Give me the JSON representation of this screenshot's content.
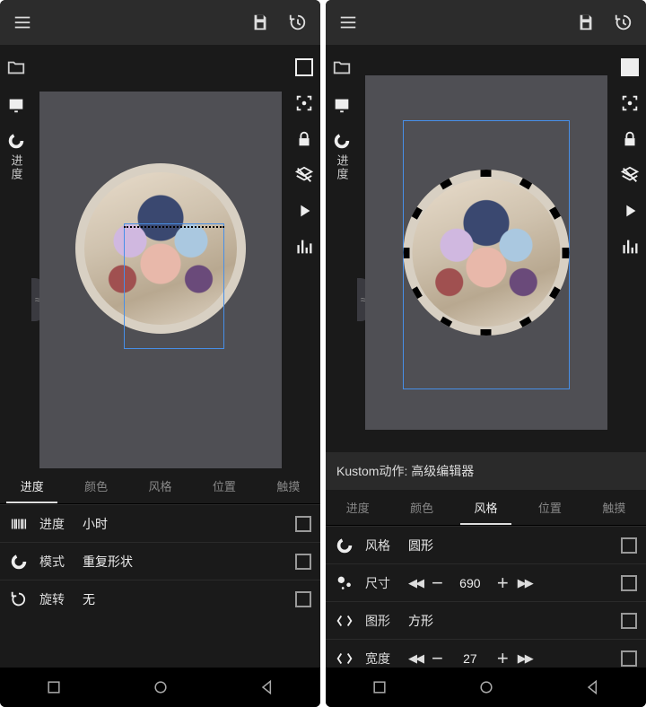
{
  "left": {
    "sidebar_sel_label": "进度",
    "tabs": [
      "进度",
      "颜色",
      "风格",
      "位置",
      "触摸"
    ],
    "active_tab": 0,
    "props": [
      {
        "icon": "barcode",
        "label": "进度",
        "value": "小时"
      },
      {
        "icon": "ring",
        "label": "模式",
        "value": "重复形状"
      },
      {
        "icon": "rotate",
        "label": "旋转",
        "value": "无"
      }
    ]
  },
  "right": {
    "sidebar_sel_label": "进度",
    "title_bar": "Kustom动作: 高级编辑器",
    "tabs": [
      "进度",
      "颜色",
      "风格",
      "位置",
      "触摸"
    ],
    "active_tab": 2,
    "props": [
      {
        "icon": "ring",
        "label": "风格",
        "value": "圆形",
        "type": "text"
      },
      {
        "icon": "dots",
        "label": "尺寸",
        "value": "690",
        "type": "step"
      },
      {
        "icon": "expand",
        "label": "图形",
        "value": "方形",
        "type": "text"
      },
      {
        "icon": "expand",
        "label": "宽度",
        "value": "27",
        "type": "step"
      }
    ]
  }
}
